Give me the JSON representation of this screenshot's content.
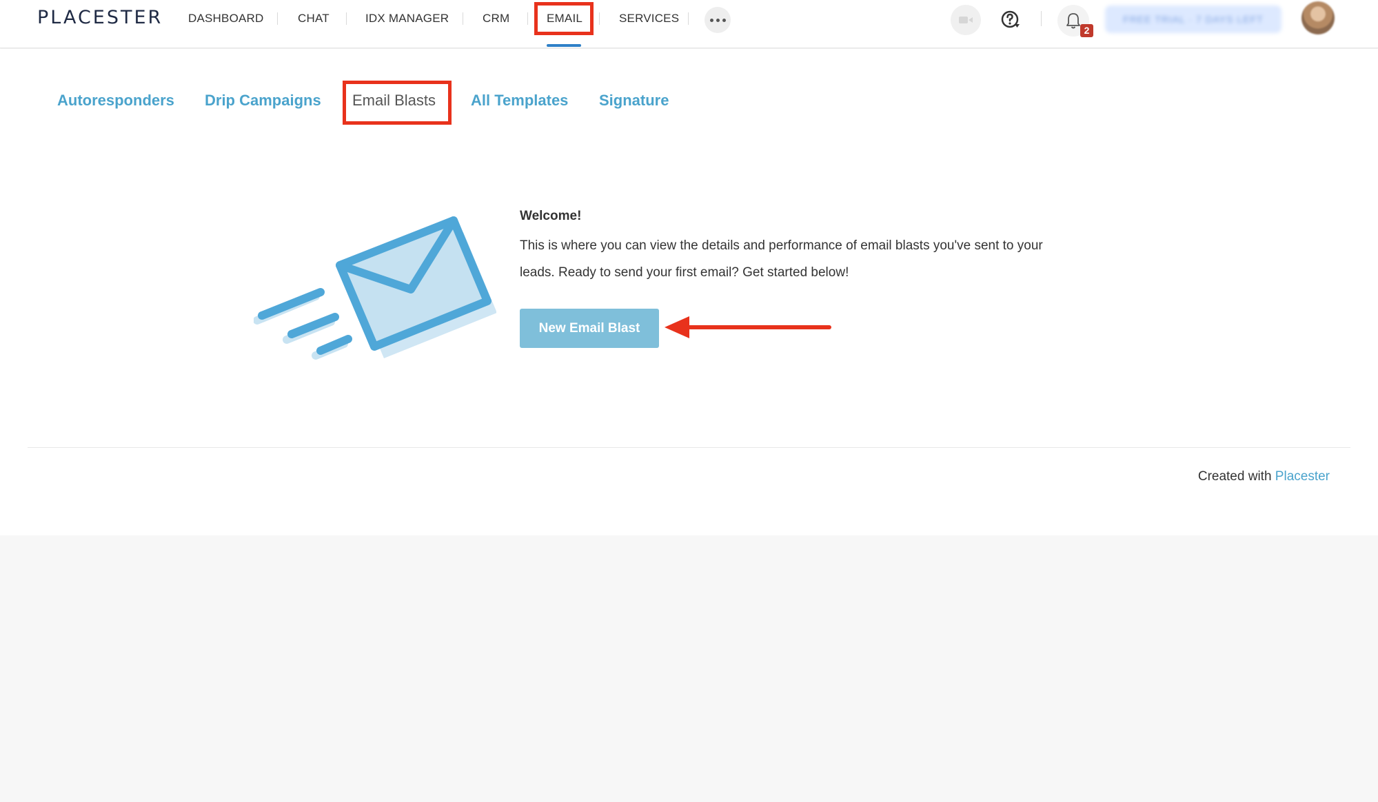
{
  "app": {
    "logo": "PLACESTER"
  },
  "nav": {
    "items": [
      {
        "label": "DASHBOARD"
      },
      {
        "label": "CHAT"
      },
      {
        "label": "IDX MANAGER"
      },
      {
        "label": "CRM"
      },
      {
        "label": "EMAIL",
        "active": true
      },
      {
        "label": "SERVICES"
      }
    ],
    "more_icon": "ellipsis-icon",
    "video_icon": "video-camera-icon",
    "help_icon": "help-question-icon",
    "bell_icon": "bell-icon",
    "notification_count": "2",
    "trial_text": "FREE TRIAL · 7 DAYS LEFT",
    "avatar_icon": "user-avatar"
  },
  "tabs": [
    {
      "label": "Autoresponders"
    },
    {
      "label": "Drip Campaigns"
    },
    {
      "label": "Email Blasts",
      "active": true
    },
    {
      "label": "All Templates"
    },
    {
      "label": "Signature"
    }
  ],
  "main": {
    "illustration_icon": "flying-envelope-icon",
    "welcome_title": "Welcome!",
    "description": "This is where you can view the details and performance of email blasts you've sent to your leads. Ready to send your first email? Get started below!",
    "cta_label": "New Email Blast"
  },
  "footer": {
    "prefix": "Created with ",
    "link": "Placester"
  },
  "colors": {
    "accent": "#4aa3cc",
    "button": "#7fbfda",
    "highlight": "#e8321c",
    "badge": "#c0392b",
    "nav_underline": "#2f80c7"
  }
}
